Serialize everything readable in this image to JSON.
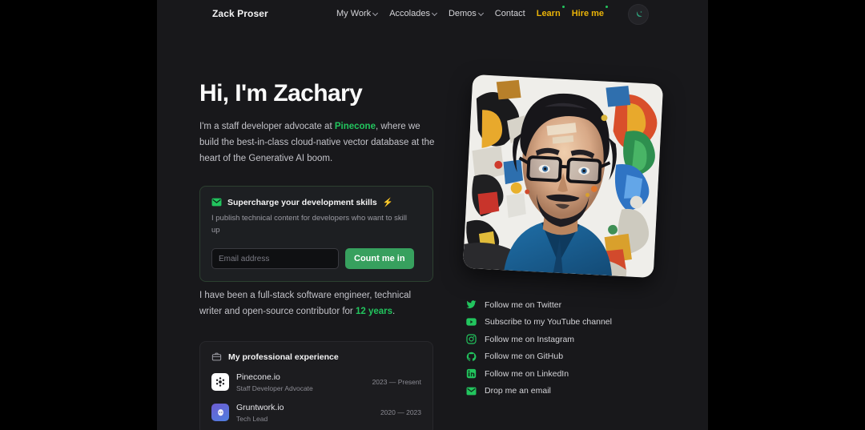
{
  "site": {
    "brand": "Zack Proser",
    "background": "#18181b",
    "accent_green": "#22c55e",
    "accent_yellow": "#eab308",
    "button_green": "#37a05e"
  },
  "nav": {
    "items": [
      {
        "label": "My Work",
        "icon": "chevron-down-icon",
        "has_chevron": true,
        "accent": false,
        "dot": false
      },
      {
        "label": "Accolades",
        "icon": "chevron-down-icon",
        "has_chevron": true,
        "accent": false,
        "dot": false
      },
      {
        "label": "Demos",
        "icon": "chevron-down-icon",
        "has_chevron": true,
        "accent": false,
        "dot": false
      },
      {
        "label": "Contact",
        "icon": "",
        "has_chevron": false,
        "accent": false,
        "dot": false
      },
      {
        "label": "Learn",
        "icon": "",
        "has_chevron": false,
        "accent": true,
        "dot": true
      },
      {
        "label": "Hire me",
        "icon": "",
        "has_chevron": false,
        "accent": true,
        "dot": true
      }
    ],
    "theme_toggle_icon": "moon-icon"
  },
  "hero": {
    "headline": "Hi, I'm Zachary",
    "intro_before": "I'm a staff developer advocate at ",
    "intro_highlight": "Pinecone",
    "intro_after": ", where we build the best-in-class cloud-native vector database at the heart of the Generative AI boom.",
    "portrait_alt": "painted-portrait"
  },
  "newsletter": {
    "icon": "envelope-icon",
    "title": "Supercharge your development skills",
    "title_emoji": "⚡",
    "subtitle": "I publish technical content for developers who want to skill up",
    "input_placeholder": "Email address",
    "input_value": "",
    "submit_label": "Count me in"
  },
  "bio": {
    "text_before": "I have been a full-stack software engineer, technical writer and open-source contributor for ",
    "highlight": "12 years",
    "text_after": "."
  },
  "experience": {
    "icon": "briefcase-icon",
    "title": "My professional experience",
    "rows": [
      {
        "company": "Pinecone.io",
        "role": "Staff Developer Advocate",
        "dates": "2023 — Present",
        "logo": "pinecone-logo"
      },
      {
        "company": "Gruntwork.io",
        "role": "Tech Lead",
        "dates": "2020 — 2023",
        "logo": "gruntwork-logo"
      }
    ]
  },
  "socials": [
    {
      "label": "Follow me on Twitter",
      "icon": "twitter-icon"
    },
    {
      "label": "Subscribe to my YouTube channel",
      "icon": "youtube-icon"
    },
    {
      "label": "Follow me on Instagram",
      "icon": "instagram-icon"
    },
    {
      "label": "Follow me on GitHub",
      "icon": "github-icon"
    },
    {
      "label": "Follow me on LinkedIn",
      "icon": "linkedin-icon"
    },
    {
      "label": "Drop me an email",
      "icon": "email-icon"
    }
  ]
}
